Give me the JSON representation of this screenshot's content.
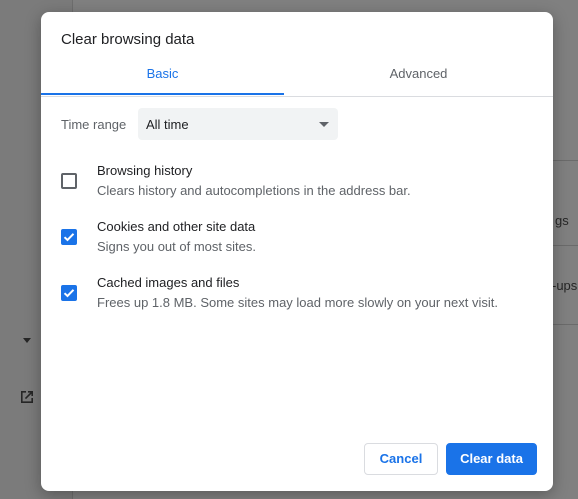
{
  "background": {
    "partial_text_1": "gs",
    "partial_text_2": "-ups,"
  },
  "dialog": {
    "title": "Clear browsing data",
    "tabs": [
      {
        "label": "Basic",
        "active": true
      },
      {
        "label": "Advanced",
        "active": false
      }
    ],
    "time_range": {
      "label": "Time range",
      "value": "All time"
    },
    "options": [
      {
        "title": "Browsing history",
        "description": "Clears history and autocompletions in the address bar.",
        "checked": false
      },
      {
        "title": "Cookies and other site data",
        "description": "Signs you out of most sites.",
        "checked": true
      },
      {
        "title": "Cached images and files",
        "description": "Frees up 1.8 MB. Some sites may load more slowly on your next visit.",
        "checked": true
      }
    ],
    "buttons": {
      "cancel": "Cancel",
      "clear": "Clear data"
    }
  },
  "colors": {
    "accent": "#1a73e8",
    "text_primary": "#202124",
    "text_secondary": "#5f6368"
  }
}
